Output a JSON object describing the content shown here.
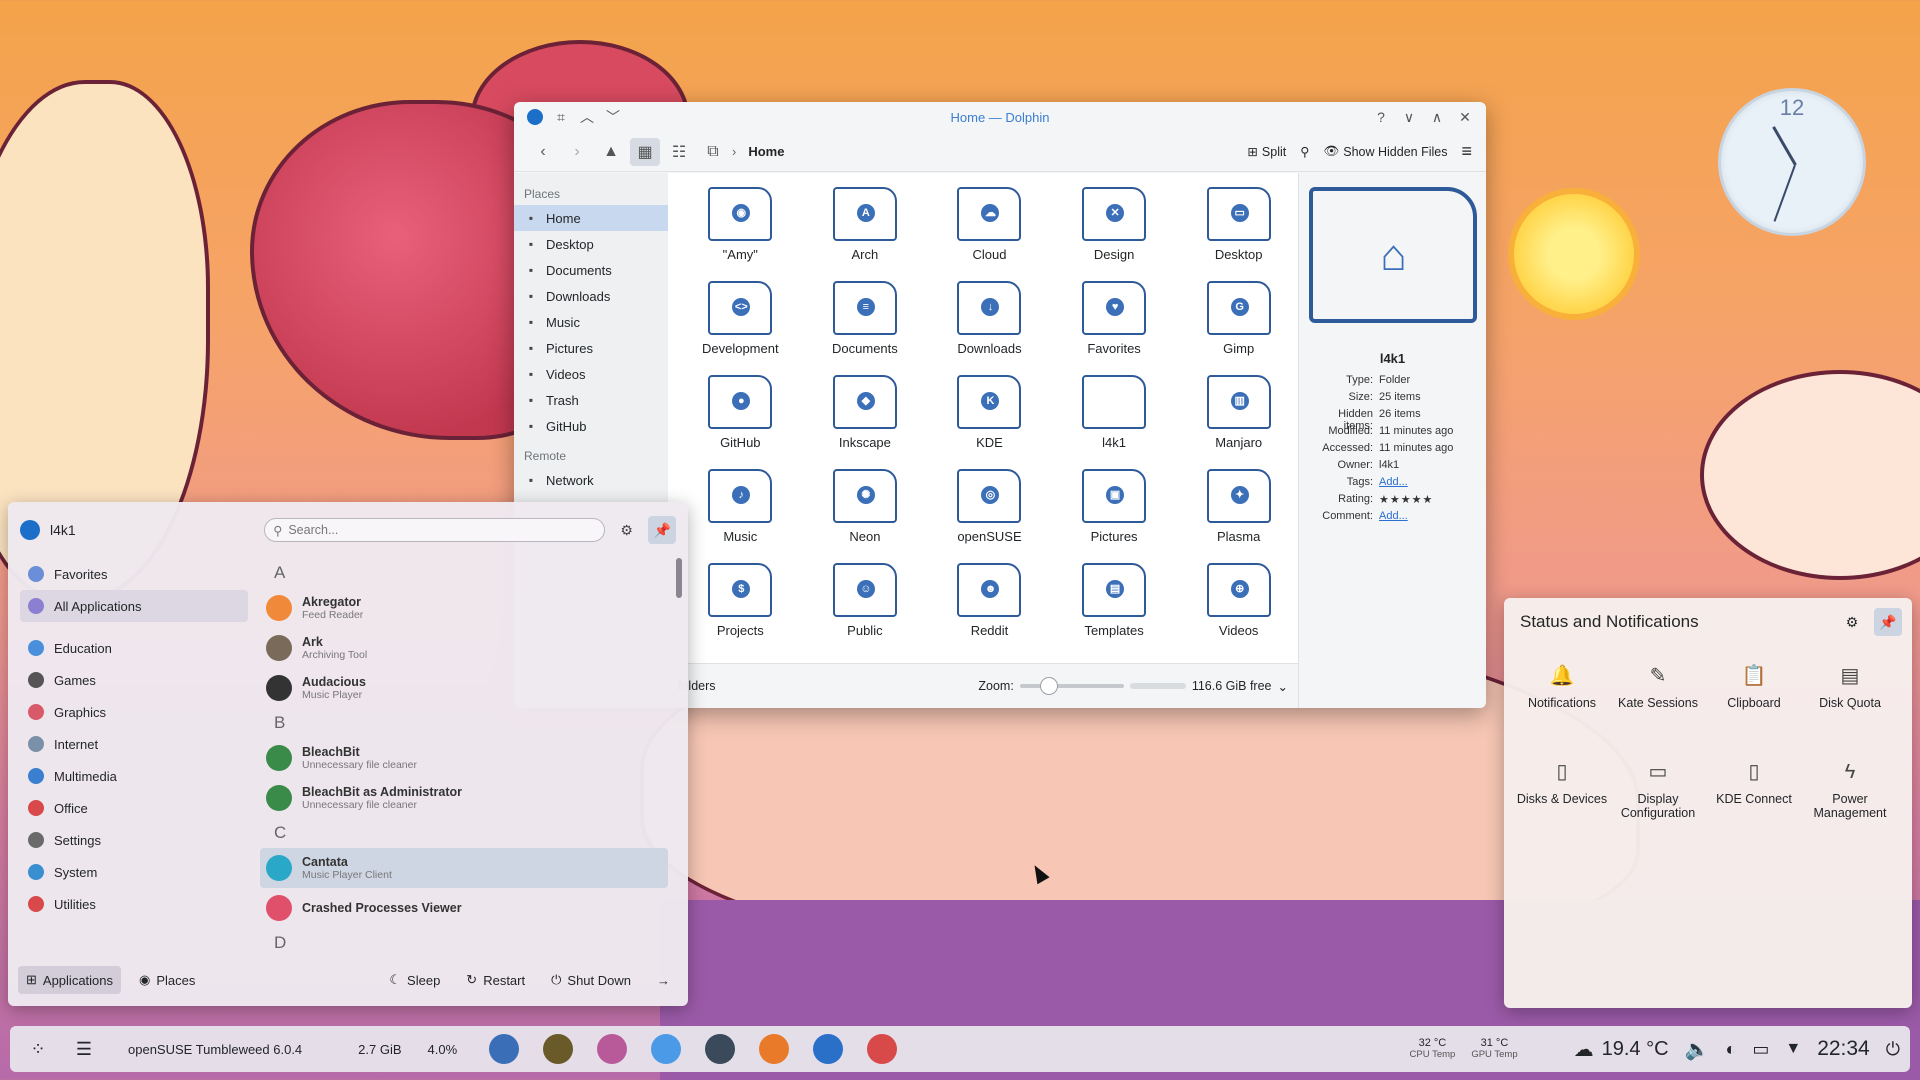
{
  "desktop": {
    "clock_number": "12"
  },
  "dolphin": {
    "title": "Home — Dolphin",
    "breadcrumb": "Home",
    "toolbar": {
      "split": "Split",
      "show_hidden": "Show Hidden Files"
    },
    "places_heading": "Places",
    "remote_heading": "Remote",
    "places": [
      {
        "label": "Home",
        "icon": "home-icon"
      },
      {
        "label": "Desktop",
        "icon": "desktop-icon"
      },
      {
        "label": "Documents",
        "icon": "documents-icon"
      },
      {
        "label": "Downloads",
        "icon": "downloads-icon"
      },
      {
        "label": "Music",
        "icon": "music-icon"
      },
      {
        "label": "Pictures",
        "icon": "pictures-icon"
      },
      {
        "label": "Videos",
        "icon": "videos-icon"
      },
      {
        "label": "Trash",
        "icon": "trash-icon"
      },
      {
        "label": "GitHub",
        "icon": "github-icon"
      }
    ],
    "remote": [
      {
        "label": "Network",
        "icon": "network-icon"
      }
    ],
    "files": [
      {
        "name": "\"Amy\"",
        "glyph": "◉"
      },
      {
        "name": "Arch",
        "glyph": "A"
      },
      {
        "name": "Cloud",
        "glyph": "☁"
      },
      {
        "name": "Design",
        "glyph": "✕"
      },
      {
        "name": "Desktop",
        "glyph": "▭"
      },
      {
        "name": "Development",
        "glyph": "<>"
      },
      {
        "name": "Documents",
        "glyph": "≡"
      },
      {
        "name": "Downloads",
        "glyph": "↓"
      },
      {
        "name": "Favorites",
        "glyph": "♥"
      },
      {
        "name": "Gimp",
        "glyph": "G"
      },
      {
        "name": "GitHub",
        "glyph": "●"
      },
      {
        "name": "Inkscape",
        "glyph": "◆"
      },
      {
        "name": "KDE",
        "glyph": "K"
      },
      {
        "name": "l4k1",
        "glyph": ""
      },
      {
        "name": "Manjaro",
        "glyph": "▥"
      },
      {
        "name": "Music",
        "glyph": "♪"
      },
      {
        "name": "Neon",
        "glyph": "✺"
      },
      {
        "name": "openSUSE",
        "glyph": "◎"
      },
      {
        "name": "Pictures",
        "glyph": "▣"
      },
      {
        "name": "Plasma",
        "glyph": "✦"
      },
      {
        "name": "Projects",
        "glyph": "$"
      },
      {
        "name": "Public",
        "glyph": "☺"
      },
      {
        "name": "Reddit",
        "glyph": "☻"
      },
      {
        "name": "Templates",
        "glyph": "▤"
      },
      {
        "name": "Videos",
        "glyph": "⊕"
      }
    ],
    "status": {
      "text": "folders",
      "zoom_label": "Zoom:",
      "free_space": "116.6 GiB free"
    },
    "info": {
      "name": "l4k1",
      "rows": [
        {
          "k": "Type:",
          "v": "Folder"
        },
        {
          "k": "Size:",
          "v": "25 items"
        },
        {
          "k": "Hidden items:",
          "v": "26 items"
        },
        {
          "k": "Modified:",
          "v": "11 minutes ago"
        },
        {
          "k": "Accessed:",
          "v": "11 minutes ago"
        },
        {
          "k": "Owner:",
          "v": "l4k1"
        }
      ],
      "tags_label": "Tags:",
      "tags_value": "Add...",
      "rating_label": "Rating:",
      "rating_stars": "★★★★★",
      "comment_label": "Comment:",
      "comment_value": "Add..."
    }
  },
  "kickoff": {
    "user": "l4k1",
    "search_placeholder": "Search...",
    "categories_top": [
      {
        "label": "Favorites",
        "color": "#6a8fd8"
      },
      {
        "label": "All Applications",
        "color": "#8a7fd0"
      }
    ],
    "categories": [
      {
        "label": "Education",
        "color": "#4a8fdc"
      },
      {
        "label": "Games",
        "color": "#555555"
      },
      {
        "label": "Graphics",
        "color": "#d85a6a"
      },
      {
        "label": "Internet",
        "color": "#7a8fa8"
      },
      {
        "label": "Multimedia",
        "color": "#3a7fd0"
      },
      {
        "label": "Office",
        "color": "#d84a4a"
      },
      {
        "label": "Settings",
        "color": "#6a6a6a"
      },
      {
        "label": "System",
        "color": "#3a8fd0"
      },
      {
        "label": "Utilities",
        "color": "#d84a4a"
      }
    ],
    "apps": [
      {
        "type": "letter",
        "text": "A"
      },
      {
        "type": "app",
        "name": "Akregator",
        "desc": "Feed Reader",
        "color": "#f08a3a"
      },
      {
        "type": "app",
        "name": "Ark",
        "desc": "Archiving Tool",
        "color": "#7a6a5a"
      },
      {
        "type": "app",
        "name": "Audacious",
        "desc": "Music Player",
        "color": "#333333"
      },
      {
        "type": "letter",
        "text": "B"
      },
      {
        "type": "app",
        "name": "BleachBit",
        "desc": "Unnecessary file cleaner",
        "color": "#3a8a4a"
      },
      {
        "type": "app",
        "name": "BleachBit as Administrator",
        "desc": "Unnecessary file cleaner",
        "color": "#3a8a4a"
      },
      {
        "type": "letter",
        "text": "C"
      },
      {
        "type": "app",
        "name": "Cantata",
        "desc": "Music Player Client",
        "color": "#2aa8c8",
        "selected": true
      },
      {
        "type": "app",
        "name": "Crashed Processes Viewer",
        "desc": "",
        "color": "#e0506a"
      },
      {
        "type": "letter",
        "text": "D"
      }
    ],
    "footer": {
      "applications": "Applications",
      "places": "Places",
      "sleep": "Sleep",
      "restart": "Restart",
      "shutdown": "Shut Down"
    }
  },
  "tray": {
    "title": "Status and Notifications",
    "items": [
      {
        "label": "Notifications",
        "icon": "bell-icon",
        "glyph": "🔔"
      },
      {
        "label": "Kate Sessions",
        "icon": "kate-icon",
        "glyph": "✎"
      },
      {
        "label": "Clipboard",
        "icon": "clipboard-icon",
        "glyph": "📋"
      },
      {
        "label": "Disk Quota",
        "icon": "disk-quota-icon",
        "glyph": "▤"
      },
      {
        "label": "Disks & Devices",
        "icon": "usb-icon",
        "glyph": "▯"
      },
      {
        "label": "Display Configuration",
        "icon": "display-icon",
        "glyph": "▭"
      },
      {
        "label": "KDE Connect",
        "icon": "phone-icon",
        "glyph": "▯"
      },
      {
        "label": "Power Management",
        "icon": "power-icon",
        "glyph": "ϟ"
      }
    ]
  },
  "taskbar": {
    "os_name": "openSUSE Tumbleweed 6.0.4",
    "memory": "2.7 GiB",
    "cpu": "4.0%",
    "apps": [
      {
        "name": "system-monitor",
        "color": "#3a6fb8"
      },
      {
        "name": "gimp",
        "color": "#6a5a2a"
      },
      {
        "name": "app-3",
        "color": "#b85a9a"
      },
      {
        "name": "app-4",
        "color": "#4a9ae8"
      },
      {
        "name": "app-5",
        "color": "#3a4a5a"
      },
      {
        "name": "firefox",
        "color": "#e87a2a"
      },
      {
        "name": "dolphin",
        "color": "#2a6fc8"
      },
      {
        "name": "app-8",
        "color": "#d84a4a"
      }
    ],
    "cpu_temp": "32 °C",
    "cpu_temp_label": "CPU Temp",
    "gpu_temp": "31 °C",
    "gpu_temp_label": "GPU Temp",
    "weather": "19.4 °C",
    "time": "22:34"
  }
}
